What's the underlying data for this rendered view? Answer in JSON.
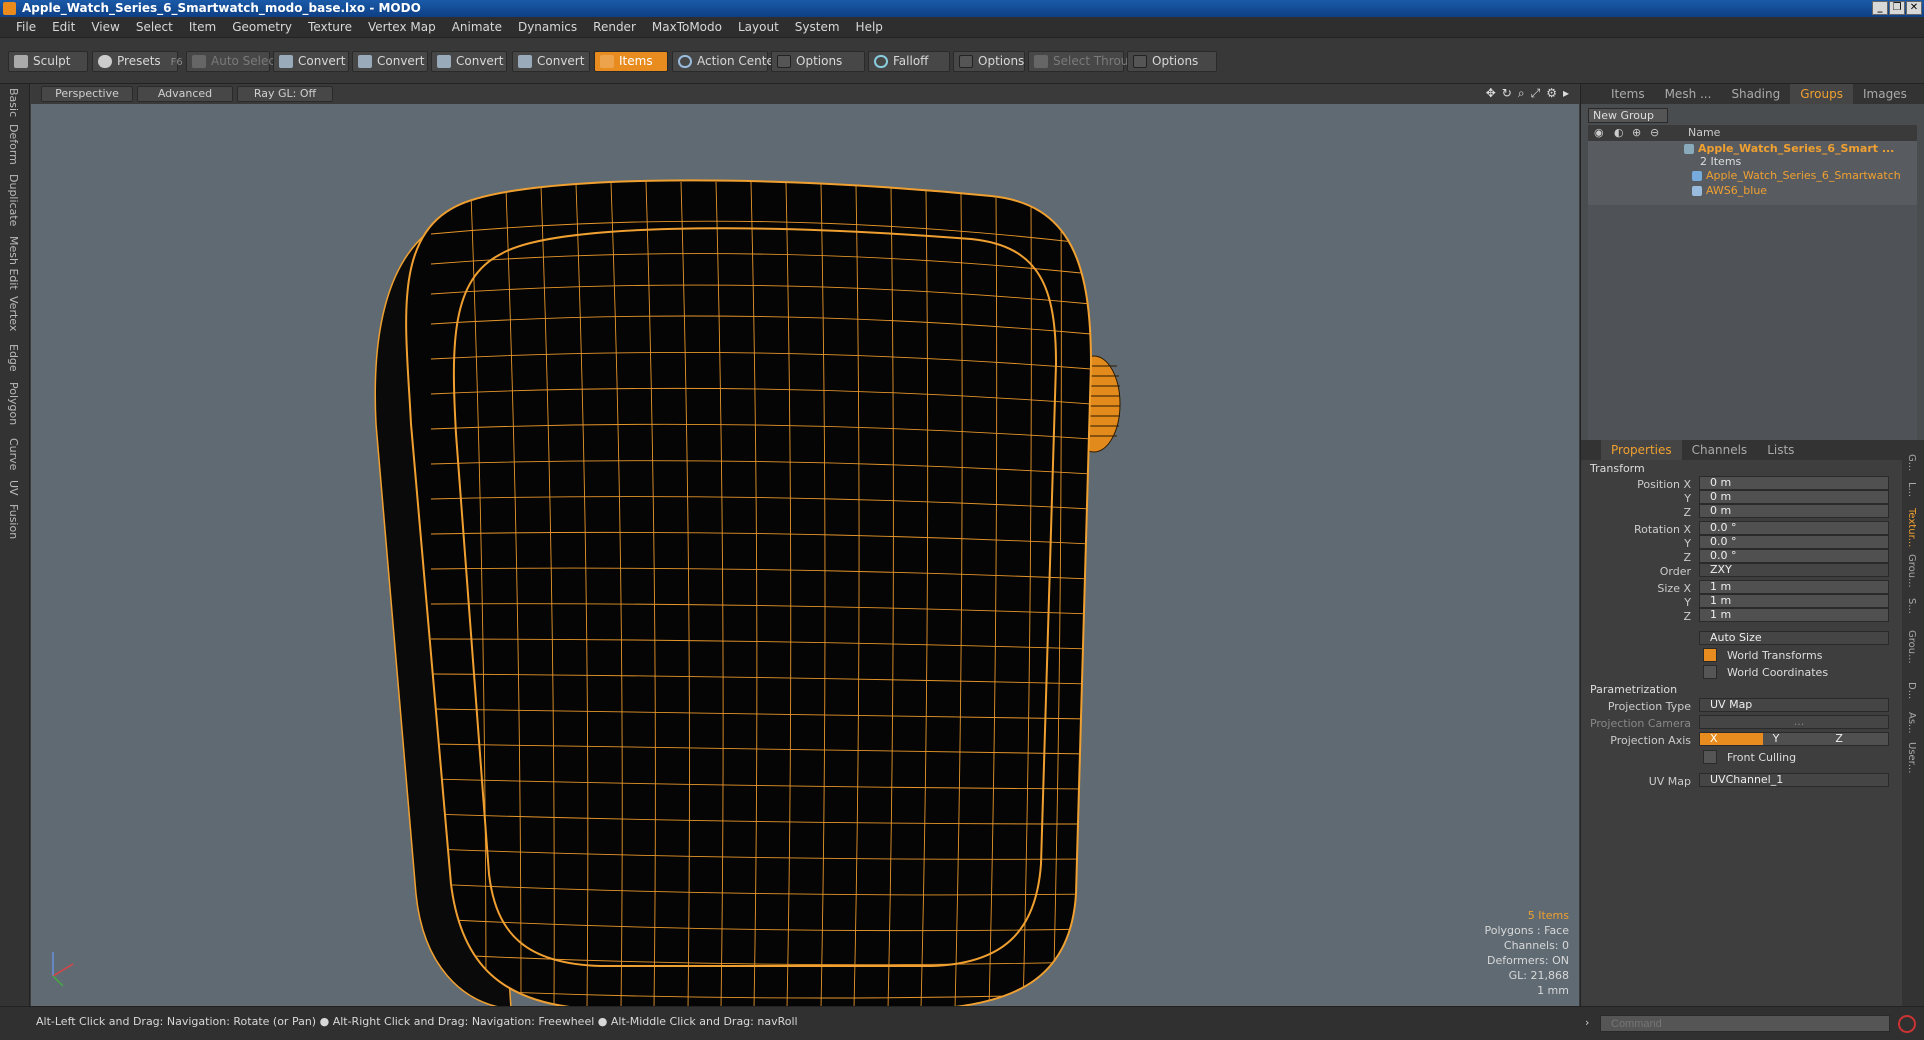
{
  "window": {
    "title": "Apple_Watch_Series_6_Smartwatch_modo_base.lxo - MODO"
  },
  "menu": [
    "File",
    "Edit",
    "View",
    "Select",
    "Item",
    "Geometry",
    "Texture",
    "Vertex Map",
    "Animate",
    "Dynamics",
    "Render",
    "MaxToModo",
    "Layout",
    "System",
    "Help"
  ],
  "toolbar": {
    "sculpt": "Sculpt",
    "presets": "Presets",
    "presets_key": "F6",
    "auto_select": "Auto Select",
    "convert1": "Convert",
    "convert2": "Convert",
    "convert3": "Convert",
    "convert4": "Convert",
    "items": "Items",
    "action_center": "Action Center",
    "options1": "Options",
    "falloff": "Falloff",
    "options2": "Options",
    "select_through": "Select Through",
    "options3": "Options"
  },
  "left_tabs": [
    "Basic",
    "Deform",
    "Duplicate",
    "Mesh Edit",
    "Vertex",
    "Edge",
    "Polygon",
    "Curve",
    "UV",
    "Fusion"
  ],
  "viewport": {
    "view": "Perspective",
    "shading": "Advanced",
    "raygl": "Ray GL: Off",
    "info": {
      "items": "5 Items",
      "polygons": "Polygons : Face",
      "channels": "Channels: 0",
      "deformers": "Deformers: ON",
      "gl": "GL: 21,868",
      "scale": "1 mm"
    }
  },
  "right_panel": {
    "top_tabs": [
      "Items",
      "Mesh ...",
      "Shading",
      "Groups",
      "Images"
    ],
    "active_top_tab": "Groups",
    "new_group": "New Group",
    "tree_header": "Name",
    "tree": {
      "group_name": "Apple_Watch_Series_6_Smart ...",
      "group_count": "2 Items",
      "child1": "Apple_Watch_Series_6_Smartwatch",
      "child2": "AWS6_blue"
    },
    "prop_tabs": [
      "Properties",
      "Channels",
      "Lists"
    ],
    "active_prop_tab": "Properties",
    "transform": {
      "section": "Transform",
      "position_label": "Position X",
      "y_label": "Y",
      "z_label": "Z",
      "pos_x": "0 m",
      "pos_y": "0 m",
      "pos_z": "0 m",
      "rotation_label": "Rotation X",
      "rot_x": "0.0 °",
      "rot_y": "0.0 °",
      "rot_z": "0.0 °",
      "order_label": "Order",
      "order": "ZXY",
      "size_label": "Size X",
      "size_x": "1 m",
      "size_y": "1 m",
      "size_z": "1 m",
      "auto_size": "Auto Size",
      "world_transforms": "World Transforms",
      "world_coordinates": "World Coordinates"
    },
    "parametrization": {
      "section": "Parametrization",
      "projection_type_label": "Projection Type",
      "projection_type": "UV Map",
      "projection_camera_label": "Projection Camera",
      "projection_camera": "...",
      "projection_axis_label": "Projection Axis",
      "axes": [
        "X",
        "Y",
        "Z"
      ],
      "front_culling": "Front Culling",
      "uv_map_label": "UV Map",
      "uv_map": "UVChannel_1"
    },
    "side_tabs": [
      "G...",
      "L...",
      "Textur...",
      "Grou...",
      "S...",
      "Grou...",
      "D...",
      "As...",
      "User..."
    ]
  },
  "status": {
    "hint": "Alt-Left Click and Drag: Navigation: Rotate (or Pan) ● Alt-Right Click and Drag: Navigation: Freewheel ● Alt-Middle Click and Drag: navRoll",
    "command_placeholder": "Command"
  },
  "colors": {
    "accent": "#e88c1f",
    "wire": "#f0a030",
    "viewport_bg": "#5f6a72"
  }
}
